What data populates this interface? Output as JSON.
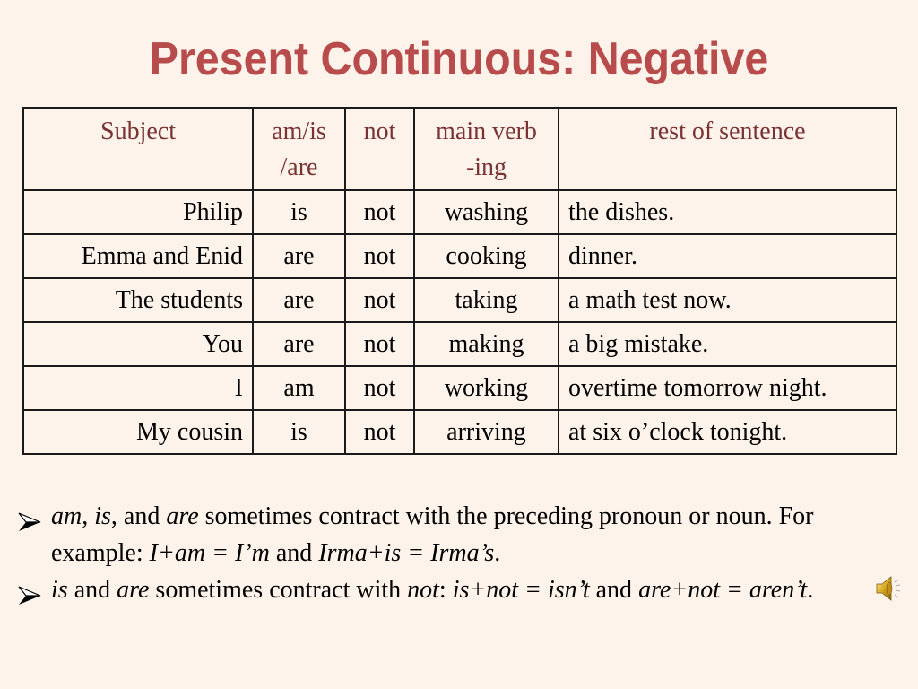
{
  "title": "Present Continuous: Negative",
  "table": {
    "headers": {
      "subject": "Subject",
      "aux_line1": "am/is",
      "aux_line2": "/are",
      "not": "not",
      "verb_line1": "main verb",
      "verb_line2": "-ing",
      "rest": "rest of sentence"
    },
    "rows": [
      {
        "subject": "Philip",
        "aux": "is",
        "not": "not",
        "verb": "washing",
        "rest": "the dishes."
      },
      {
        "subject": "Emma and Enid",
        "aux": "are",
        "not": "not",
        "verb": "cooking",
        "rest": "dinner."
      },
      {
        "subject": "The students",
        "aux": "are",
        "not": "not",
        "verb": "taking",
        "rest": "a math test now."
      },
      {
        "subject": "You",
        "aux": "are",
        "not": "not",
        "verb": "making",
        "rest": "a big mistake."
      },
      {
        "subject": "I",
        "aux": "am",
        "not": "not",
        "verb": "working",
        "rest": "overtime tomorrow night."
      },
      {
        "subject": "My cousin",
        "aux": "is",
        "not": "not",
        "verb": "arriving",
        "rest": "at six o’clock tonight."
      }
    ]
  },
  "notes": [
    {
      "bullet_icon": "arrowhead-bullet-icon",
      "segments": [
        {
          "text": "am",
          "italic": true
        },
        {
          "text": ", ",
          "italic": false
        },
        {
          "text": "is",
          "italic": true
        },
        {
          "text": ", and ",
          "italic": false
        },
        {
          "text": "are",
          "italic": true
        },
        {
          "text": " sometimes contract with the preceding pronoun or noun. For example: ",
          "italic": false
        },
        {
          "text": "I+am = I’m",
          "italic": true
        },
        {
          "text": " and ",
          "italic": false
        },
        {
          "text": "Irma+is = Irma’s",
          "italic": true
        },
        {
          "text": ".",
          "italic": false
        }
      ]
    },
    {
      "bullet_icon": "arrowhead-bullet-icon",
      "segments": [
        {
          "text": "is",
          "italic": true
        },
        {
          "text": " and ",
          "italic": false
        },
        {
          "text": "are",
          "italic": true
        },
        {
          "text": " sometimes contract with ",
          "italic": false
        },
        {
          "text": "not",
          "italic": true
        },
        {
          "text": ": ",
          "italic": false
        },
        {
          "text": "is+not = isn’t",
          "italic": true
        },
        {
          "text": " and ",
          "italic": false
        },
        {
          "text": "are+not = aren’t",
          "italic": true
        },
        {
          "text": ".",
          "italic": false
        }
      ],
      "trailing_icon": "speaker-audio-icon"
    }
  ],
  "colors": {
    "background": "#fdf3ea",
    "title": "#b84b4b",
    "header_text": "#7a3333",
    "body_text": "#000000",
    "border": "#1a1a1a"
  }
}
